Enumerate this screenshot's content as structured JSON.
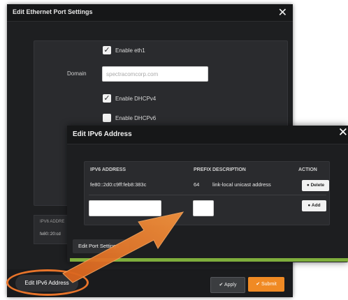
{
  "outer_dialog": {
    "title": "Edit Ethernet Port Settings",
    "close_icon": "close-icon",
    "enable_eth1_label": "Enable eth1",
    "enable_eth1_checked": true,
    "domain_label": "Domain",
    "domain_placeholder": "spectracomcorp.com",
    "enable_dhcpv4_label": "Enable DHCPv4",
    "enable_dhcpv4_checked": true,
    "enable_dhcpv6_label": "Enable DHCPv6",
    "enable_dhcpv6_checked": false,
    "ipv6_section_header": "IPV6 ADDRE",
    "ipv6_section_value": "fe80::20:cd",
    "edit_ipv6_button": "Edit IPv6 Address",
    "apply_button": "✔ Apply",
    "submit_button": "✔ Submit"
  },
  "inner_dialog": {
    "title": "Edit IPv6 Address",
    "close_icon": "close-icon",
    "columns": [
      "IPV6 ADDRESS",
      "PREFIX",
      "DESCRIPTION",
      "ACTION"
    ],
    "rows": [
      {
        "address": "fe80::2d0:c9ff:feb8:383c",
        "prefix": "64",
        "description": "link-local unicast address",
        "action": "● Delete"
      }
    ],
    "add_button": "● Add",
    "edit_port_settings_button": "Edit Port Settings"
  },
  "colors": {
    "accent_orange": "#f08a24",
    "highlight_ring": "#e8742a",
    "green_bar": "#7fae3c",
    "dialog_bg": "#1d1e20"
  }
}
